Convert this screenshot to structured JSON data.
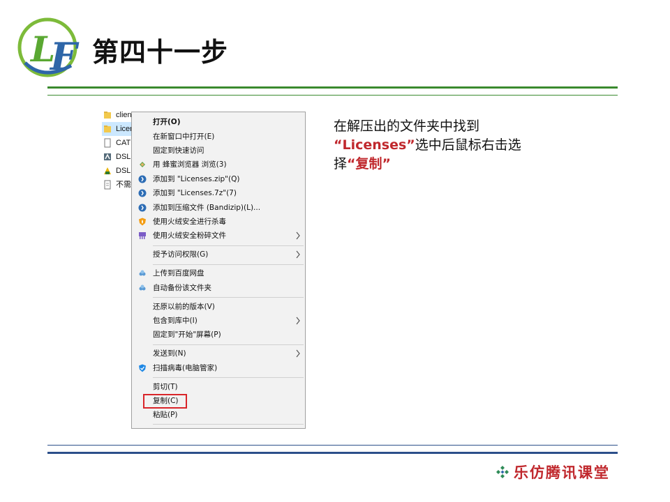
{
  "header": {
    "logo_letters": "LF",
    "title": "第四十一步"
  },
  "explorer": {
    "files": [
      {
        "name": "clien",
        "icon": "folder-icon"
      },
      {
        "name": "Licen",
        "icon": "folder-icon",
        "selected": true
      },
      {
        "name": "CAT",
        "icon": "document-icon"
      },
      {
        "name": "DSL",
        "icon": "app-icon"
      },
      {
        "name": "DSL",
        "icon": "app-icon"
      },
      {
        "name": "不需",
        "icon": "text-file-icon"
      }
    ]
  },
  "context_menu": {
    "items": [
      {
        "label": "打开(O)",
        "bold": true
      },
      {
        "label": "在新窗口中打开(E)"
      },
      {
        "label": "固定到快速访问"
      },
      {
        "label": "用 蜂蜜浏览器 浏览(3)",
        "icon": "browser-icon"
      },
      {
        "label": "添加到 \"Licenses.zip\"(Q)",
        "icon": "bandizip-icon"
      },
      {
        "label": "添加到 \"Licenses.7z\"(7)",
        "icon": "bandizip-icon"
      },
      {
        "label": "添加到压缩文件 (Bandizip)(L)...",
        "icon": "bandizip-icon"
      },
      {
        "label": "使用火绒安全进行杀毒",
        "icon": "huorong-shield-icon"
      },
      {
        "label": "使用火绒安全粉碎文件",
        "icon": "shredder-icon",
        "submenu": true
      },
      {
        "label": "授予访问权限(G)",
        "submenu": true
      },
      {
        "label": "上传到百度网盘",
        "icon": "baidu-cloud-icon"
      },
      {
        "label": "自动备份该文件夹",
        "icon": "baidu-cloud-icon"
      },
      {
        "label": "还原以前的版本(V)"
      },
      {
        "label": "包含到库中(I)",
        "submenu": true
      },
      {
        "label": "固定到\"开始\"屏幕(P)"
      },
      {
        "label": "发送到(N)",
        "submenu": true
      },
      {
        "label": "扫描病毒(电脑管家)",
        "icon": "pc-manager-icon"
      },
      {
        "label": "剪切(T)"
      },
      {
        "label": "复制(C)",
        "highlighted": true
      },
      {
        "label": "粘贴(P)"
      }
    ]
  },
  "instruction": {
    "line1": "在解压出的文件夹中找到",
    "quote1": "“Licenses”",
    "line2_rest": "选中后鼠标右击选",
    "line3_pre": "择",
    "quote2": "“复制”"
  },
  "footer": {
    "brand": "乐仿腾讯课堂"
  },
  "colors": {
    "accent_red": "#c0282d",
    "rule_green": "#3a8a2e",
    "rule_blue": "#2c4f8a",
    "highlight_box": "#d9252a",
    "selection": "#cce8ff"
  }
}
